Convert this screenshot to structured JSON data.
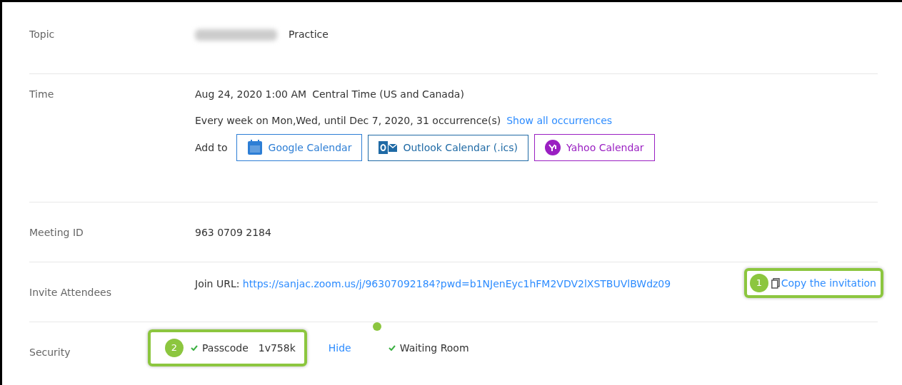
{
  "rows": [
    {
      "kind": "topic",
      "label": "Topic",
      "redacted": true,
      "text": "Practice"
    },
    {
      "kind": "time",
      "label": "Time",
      "when": "Aug 24, 2020 1:00 AM",
      "timezone": "Central Time (US and Canada)",
      "recurrence": "Every week on Mon,Wed, until Dec 7, 2020, 31 occurrence(s)",
      "recurrence_link": "Show all occurrences",
      "add_to": "Add to",
      "calendars": [
        {
          "kind": "google",
          "label": "Google Calendar",
          "color": "#2d7ed5"
        },
        {
          "kind": "outlook",
          "label": "Outlook Calendar (.ics)",
          "color": "#1f6aa5"
        },
        {
          "kind": "yahoo",
          "label": "Yahoo Calendar",
          "color": "#9a1fc2"
        }
      ]
    },
    {
      "kind": "plain",
      "label": "Meeting ID",
      "text": "963 0709 2184"
    },
    {
      "kind": "invite",
      "label": "Invite Attendees",
      "url_label": "Join URL:",
      "url": "https://sanjac.zoom.us/j/96307092184?pwd=b1NJenEyc1hFM2VDV2lXSTBUVlBWdz09",
      "copy": "Copy the invitation",
      "callout": "1"
    },
    {
      "kind": "security",
      "label": "Security",
      "callout": "2",
      "options": [
        {
          "label": "Passcode",
          "value": "1v758k",
          "link": "Hide",
          "checked": true
        },
        {
          "label": "Waiting Room",
          "checked": true
        }
      ]
    }
  ]
}
